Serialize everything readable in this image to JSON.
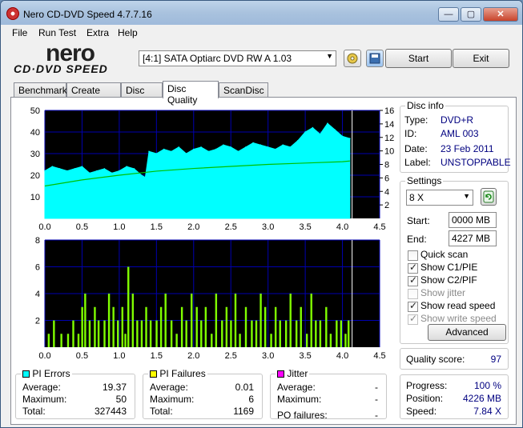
{
  "window": {
    "title": "Nero CD-DVD Speed 4.7.7.16"
  },
  "menu": [
    "File",
    "Run Test",
    "Extra",
    "Help"
  ],
  "logo": {
    "top": "nero",
    "bottom": "CD·DVD SPEED"
  },
  "drive": {
    "selected": "[4:1]   SATA Optiarc DVD RW A 1.03"
  },
  "buttons": {
    "start": "Start",
    "exit": "Exit",
    "advanced": "Advanced"
  },
  "tabs": [
    "Benchmark",
    "Create Disc",
    "Disc Info",
    "Disc Quality",
    "ScanDisc"
  ],
  "disc_info": {
    "title": "Disc info",
    "type_label": "Type:",
    "type": "DVD+R",
    "id_label": "ID:",
    "id": "AML 003",
    "date_label": "Date:",
    "date": "23 Feb 2011",
    "label_label": "Label:",
    "label": "UNSTOPPABLE"
  },
  "settings": {
    "title": "Settings",
    "speed": "8 X",
    "start_label": "Start:",
    "start": "0000 MB",
    "end_label": "End:",
    "end": "4227 MB",
    "quick_scan": "Quick scan",
    "show_c1": "Show C1/PIE",
    "show_c2": "Show C2/PIF",
    "show_jitter": "Show jitter",
    "show_read": "Show read speed",
    "show_write": "Show write speed"
  },
  "checks": {
    "quick_scan": false,
    "show_c1": true,
    "show_c2": true,
    "show_jitter": false,
    "show_read": true,
    "show_write": true
  },
  "quality": {
    "label": "Quality score:",
    "value": "97"
  },
  "progress": {
    "progress_label": "Progress:",
    "progress": "100 %",
    "position_label": "Position:",
    "position": "4226 MB",
    "speed_label": "Speed:",
    "speed": "7.84 X"
  },
  "pi_errors": {
    "title": "PI Errors",
    "color": "#00ffff",
    "avg_label": "Average:",
    "avg": "19.37",
    "max_label": "Maximum:",
    "max": "50",
    "total_label": "Total:",
    "total": "327443"
  },
  "pi_failures": {
    "title": "PI Failures",
    "color": "#ffff00",
    "avg_label": "Average:",
    "avg": "0.01",
    "max_label": "Maximum:",
    "max": "6",
    "total_label": "Total:",
    "total": "1169"
  },
  "jitter": {
    "title": "Jitter",
    "color": "#ff00ff",
    "avg_label": "Average:",
    "avg": "-",
    "max_label": "Maximum:",
    "max": "-",
    "pof_label": "PO failures:",
    "pof": "-"
  },
  "chart_data": [
    {
      "type": "area",
      "xlim": [
        0,
        4.5
      ],
      "ylim": [
        0,
        50
      ],
      "y2lim": [
        0,
        16
      ],
      "xticks": [
        "0.0",
        "0.5",
        "1.0",
        "1.5",
        "2.0",
        "2.5",
        "3.0",
        "3.5",
        "4.0",
        "4.5"
      ],
      "yticks": [
        "10",
        "20",
        "30",
        "40",
        "50"
      ],
      "y2ticks": [
        "2",
        "4",
        "6",
        "8",
        "10",
        "12",
        "14",
        "16"
      ],
      "series": [
        {
          "color": "#00ffff",
          "x": [
            0,
            0.1,
            0.2,
            0.3,
            0.4,
            0.5,
            0.6,
            0.7,
            0.8,
            0.9,
            1.0,
            1.1,
            1.2,
            1.3,
            1.35,
            1.4,
            1.5,
            1.6,
            1.7,
            1.8,
            1.9,
            2.0,
            2.1,
            2.2,
            2.3,
            2.4,
            2.5,
            2.6,
            2.7,
            2.8,
            2.9,
            3.0,
            3.1,
            3.2,
            3.3,
            3.4,
            3.5,
            3.6,
            3.7,
            3.8,
            3.9,
            4.0,
            4.1
          ],
          "y": [
            22,
            24,
            23,
            22,
            23,
            24,
            21,
            22,
            23,
            21,
            22,
            24,
            23,
            20,
            19,
            31,
            30,
            32,
            31,
            33,
            30,
            32,
            33,
            31,
            32,
            34,
            33,
            31,
            33,
            35,
            34,
            33,
            32,
            34,
            33,
            36,
            40,
            42,
            39,
            44,
            41,
            38,
            37
          ]
        },
        {
          "color": "#00c000",
          "x": [
            0,
            0.5,
            1.0,
            1.5,
            2.0,
            2.5,
            3.0,
            3.5,
            4.0,
            4.1
          ],
          "y": [
            4.8,
            5.7,
            6.4,
            7.0,
            7.4,
            7.7,
            8.0,
            8.2,
            8.4,
            8.5
          ]
        }
      ]
    },
    {
      "type": "bar",
      "xlim": [
        0,
        4.5
      ],
      "ylim": [
        0,
        8
      ],
      "xticks": [
        "0.0",
        "0.5",
        "1.0",
        "1.5",
        "2.0",
        "2.5",
        "3.0",
        "3.5",
        "4.0",
        "4.5"
      ],
      "yticks": [
        "2",
        "4",
        "6",
        "8"
      ],
      "series": [
        {
          "color": "#80ff00",
          "x": [
            0.05,
            0.12,
            0.22,
            0.31,
            0.38,
            0.45,
            0.5,
            0.54,
            0.6,
            0.67,
            0.72,
            0.8,
            0.86,
            0.92,
            0.98,
            1.04,
            1.08,
            1.12,
            1.18,
            1.24,
            1.3,
            1.36,
            1.42,
            1.5,
            1.56,
            1.62,
            1.7,
            1.77,
            1.84,
            1.9,
            1.97,
            2.04,
            2.1,
            2.16,
            2.24,
            2.3,
            2.38,
            2.44,
            2.5,
            2.56,
            2.62,
            2.7,
            2.78,
            2.84,
            2.9,
            2.96,
            3.04,
            3.1,
            3.16,
            3.24,
            3.3,
            3.38,
            3.44,
            3.52,
            3.58,
            3.64,
            3.7,
            3.78,
            3.84,
            3.92,
            3.98,
            4.04,
            4.08
          ],
          "y": [
            1,
            2,
            1,
            1,
            2,
            1,
            3,
            4,
            2,
            3,
            2,
            2,
            4,
            3,
            2,
            3,
            1,
            6,
            4,
            2,
            2,
            3,
            2,
            2,
            3,
            4,
            2,
            1,
            3,
            2,
            4,
            3,
            2,
            3,
            1,
            4,
            2,
            3,
            2,
            4,
            1,
            3,
            2,
            2,
            4,
            3,
            1,
            3,
            2,
            2,
            4,
            2,
            3,
            1,
            4,
            2,
            2,
            3,
            1,
            2,
            2,
            1,
            2
          ]
        }
      ]
    }
  ]
}
